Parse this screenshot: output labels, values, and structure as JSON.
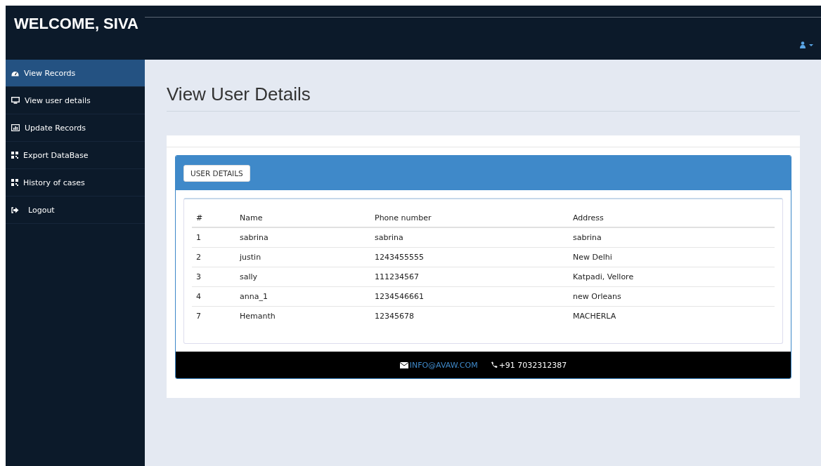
{
  "header": {
    "title": "WELCOME, SIVA"
  },
  "sidebar": {
    "items": [
      {
        "label": "View Records",
        "kind": "dashboard",
        "selected": true
      },
      {
        "label": "View user details",
        "kind": "desktop",
        "selected": false
      },
      {
        "label": "Update Records",
        "kind": "chart",
        "selected": false
      },
      {
        "label": "Export DataBase",
        "kind": "grid",
        "selected": false
      },
      {
        "label": "History of cases",
        "kind": "grid",
        "selected": false
      },
      {
        "label": "Logout",
        "kind": "signout",
        "selected": false
      }
    ]
  },
  "page": {
    "heading": "View User Details"
  },
  "panel": {
    "button": "USER DETAILS"
  },
  "table": {
    "columns": [
      "#",
      "Name",
      "Phone number",
      "Address"
    ],
    "rows": [
      [
        "1",
        "sabrina",
        "sabrina",
        "sabrina"
      ],
      [
        "2",
        "justin",
        "1243455555",
        "New Delhi"
      ],
      [
        "3",
        "sally",
        "111234567",
        "Katpadi, Vellore"
      ],
      [
        "4",
        "anna_1",
        "1234546661",
        "new Orleans"
      ],
      [
        "7",
        "Hemanth",
        "12345678",
        "MACHERLA"
      ]
    ]
  },
  "footer": {
    "email": "INFO@AVAW.COM",
    "phone": "+91 7032312387"
  }
}
